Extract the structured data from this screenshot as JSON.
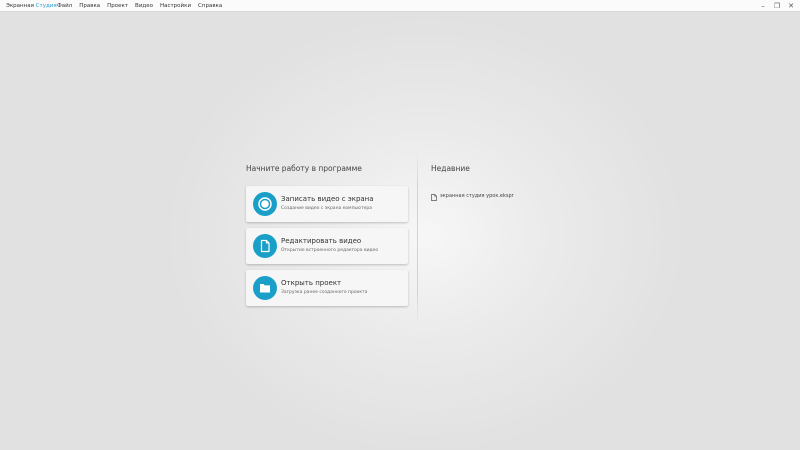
{
  "app": {
    "title_part1": "Экранная",
    "title_part2": "Студия"
  },
  "menu": {
    "items": [
      "Файл",
      "Правка",
      "Проект",
      "Видео",
      "Настройки",
      "Справка"
    ]
  },
  "window_controls": {
    "minimize": "–",
    "restore": "❐",
    "close": "✕"
  },
  "start": {
    "heading": "Начните работу в программе",
    "cards": [
      {
        "title": "Записать видео с экрана",
        "subtitle": "Создание видео с экрана компьютера",
        "icon": "record-icon"
      },
      {
        "title": "Редактировать видео",
        "subtitle": "Открытие встроенного редактора видео",
        "icon": "document-icon"
      },
      {
        "title": "Открыть проект",
        "subtitle": "Загрузка ранее созданного проекта",
        "icon": "folder-icon"
      }
    ]
  },
  "recent": {
    "heading": "Недавние",
    "items": [
      {
        "name": "экранная студия урок.ekspr",
        "icon": "file-icon"
      }
    ]
  },
  "colors": {
    "accent": "#1a9fc9",
    "brand_text": "#2a9fd0"
  }
}
